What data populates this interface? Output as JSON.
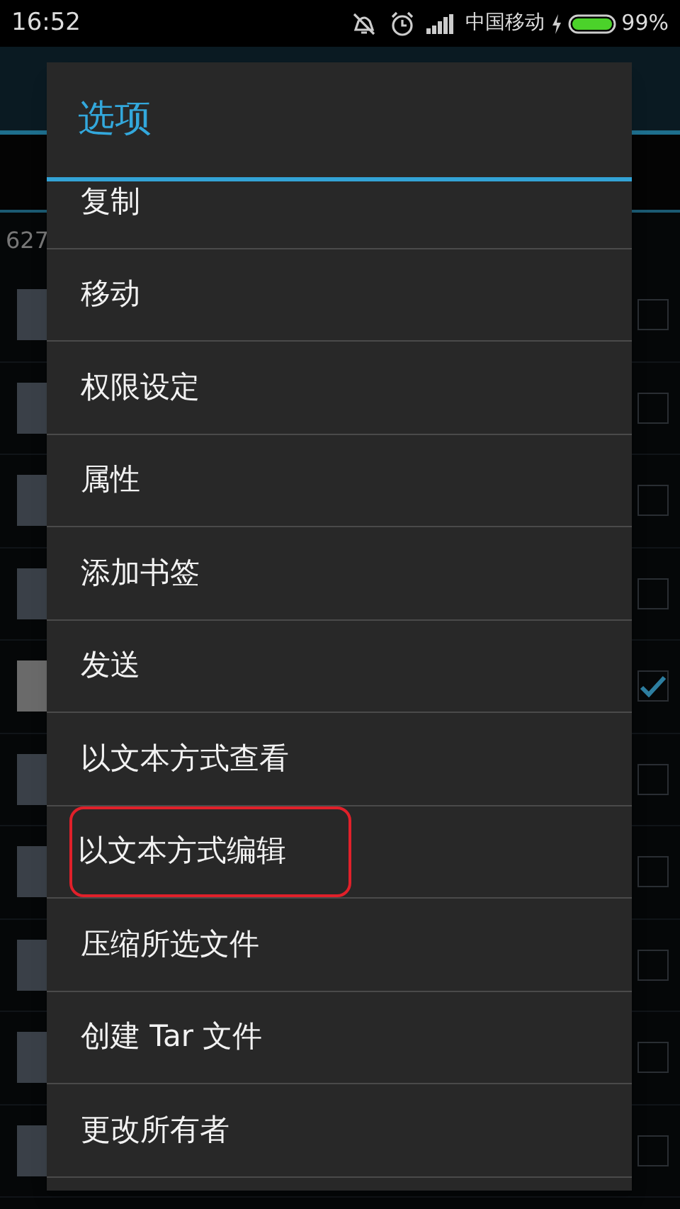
{
  "status_bar": {
    "time": "16:52",
    "carrier": "中国移动",
    "battery": "99%"
  },
  "background": {
    "count": "627",
    "rows": [
      {
        "checked": false
      },
      {
        "checked": false
      },
      {
        "checked": false
      },
      {
        "checked": false
      },
      {
        "checked": true
      },
      {
        "checked": false
      },
      {
        "checked": false
      },
      {
        "checked": false
      },
      {
        "checked": false
      },
      {
        "checked": false
      }
    ]
  },
  "dialog": {
    "title": "选项",
    "items": [
      {
        "label": "复制",
        "annotated": false
      },
      {
        "label": "移动",
        "annotated": false
      },
      {
        "label": "权限设定",
        "annotated": false
      },
      {
        "label": "属性",
        "annotated": false
      },
      {
        "label": "添加书签",
        "annotated": false
      },
      {
        "label": "发送",
        "annotated": false
      },
      {
        "label": "以文本方式查看",
        "annotated": false
      },
      {
        "label": "以文本方式编辑",
        "annotated": true
      },
      {
        "label": "压缩所选文件",
        "annotated": false
      },
      {
        "label": "创建 Tar 文件",
        "annotated": false
      },
      {
        "label": "更改所有者",
        "annotated": false
      }
    ]
  }
}
